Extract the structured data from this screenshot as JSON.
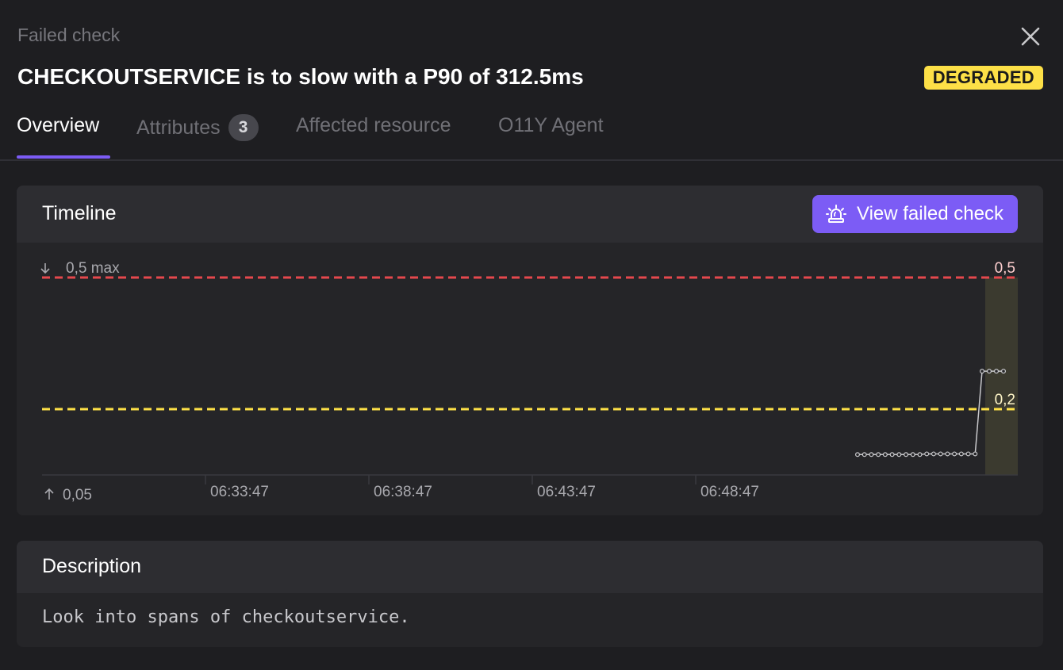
{
  "header": {
    "eyebrow": "Failed check",
    "title": "CHECKOUTSERVICE is to slow with a P90 of 312.5ms",
    "status_badge": "DEGRADED",
    "close_icon": "close-icon"
  },
  "tabs": [
    {
      "label": "Overview",
      "active": true
    },
    {
      "label": "Attributes",
      "count": "3",
      "active": false
    },
    {
      "label": "Affected resource",
      "active": false
    },
    {
      "label": "O11Y Agent",
      "active": false
    }
  ],
  "timeline": {
    "title": "Timeline",
    "button_label": "View failed check",
    "button_icon": "siren-icon",
    "max_label": "0,5 max",
    "min_label": "0,05"
  },
  "chart_data": {
    "type": "line",
    "x_ticks": [
      "06:33:47",
      "06:38:47",
      "06:43:47",
      "06:48:47"
    ],
    "y_range": [
      0.05,
      0.5
    ],
    "thresholds": [
      {
        "label": "0,5",
        "value": 0.5,
        "color": "#e5484d"
      },
      {
        "label": "0,2",
        "value": 0.2,
        "color": "#fde047"
      }
    ],
    "series": [
      {
        "values": [
          0.0965,
          0.0965,
          0.0965,
          0.0965,
          0.0965,
          0.0965,
          0.0965,
          0.0965,
          0.0965,
          0.0965,
          0.098,
          0.098,
          0.098,
          0.098,
          0.098,
          0.098,
          0.098,
          0.098,
          0.2865,
          0.2865,
          0.2865,
          0.2865
        ]
      }
    ],
    "highlight": "failed window",
    "colors": {
      "line": "#c9c9cc",
      "highlight": "#3b3a2f",
      "axis": "#3a3a3f"
    }
  },
  "description": {
    "title": "Description",
    "body": "Look into spans of checkoutservice."
  }
}
